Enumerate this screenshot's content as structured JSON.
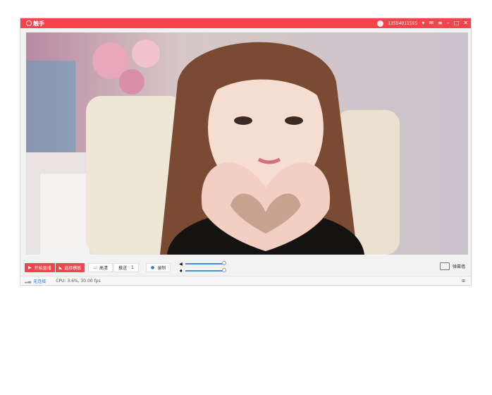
{
  "app": {
    "title": "触手",
    "account": "13554011595"
  },
  "toolbar": {
    "start_live": "开始直播",
    "choose_template": "选择模板",
    "quality": "高清",
    "push_label": "推送",
    "push_value": "1",
    "record": "录制",
    "danmu": "弹幕墙"
  },
  "status": {
    "connection": "无连接",
    "cpu": "CPU: 3.6%, 30.00 fps"
  },
  "colors": {
    "accent": "#f2444a",
    "link": "#2b7bd8"
  }
}
